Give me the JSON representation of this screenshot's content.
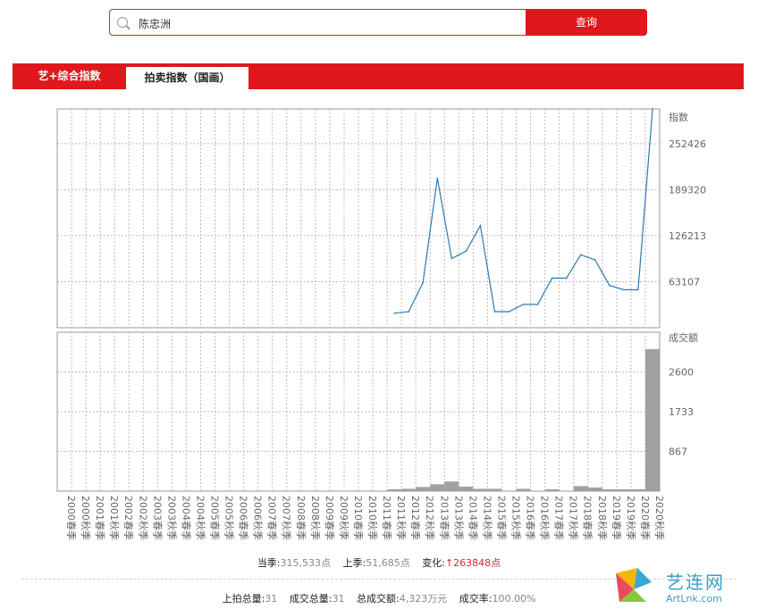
{
  "search": {
    "value": "陈忠洲",
    "button_label": "查询"
  },
  "tabs": [
    {
      "label": "艺+综合指数",
      "active": false
    },
    {
      "label": "拍卖指数（国画）",
      "active": true
    }
  ],
  "chart_data": [
    {
      "type": "line",
      "ylabel": "指数",
      "y_ticks": [
        63107,
        126213,
        189320,
        252426
      ],
      "ylim": [
        0,
        300000
      ],
      "x": [
        "2000春季",
        "2000秋季",
        "2001春季",
        "2001秋季",
        "2002春季",
        "2002秋季",
        "2003春季",
        "2003秋季",
        "2004春季",
        "2004秋季",
        "2005春季",
        "2005秋季",
        "2006春季",
        "2006秋季",
        "2007春季",
        "2007秋季",
        "2008春季",
        "2008秋季",
        "2009春季",
        "2009秋季",
        "2010春季",
        "2010秋季",
        "2011春季",
        "2011秋季",
        "2012春季",
        "2012秋季",
        "2013春季",
        "2013秋季",
        "2014春季",
        "2014秋季",
        "2015春季",
        "2015秋季",
        "2016春季",
        "2016秋季",
        "2017春季",
        "2017秋季",
        "2018春季",
        "2018秋季",
        "2019春季",
        "2019秋季",
        "2020春季",
        "2020秋季"
      ],
      "series": [
        {
          "color": "#2a7ab0",
          "values": [
            null,
            null,
            null,
            null,
            null,
            null,
            null,
            null,
            null,
            null,
            null,
            null,
            null,
            null,
            null,
            null,
            null,
            null,
            null,
            null,
            null,
            null,
            null,
            20000,
            22000,
            62000,
            205000,
            95000,
            105000,
            140000,
            22000,
            22000,
            32000,
            32000,
            68000,
            68000,
            100000,
            93000,
            58000,
            52000,
            52000,
            300000
          ]
        }
      ],
      "grid": true
    },
    {
      "type": "bar",
      "ylabel": "成交额",
      "y_ticks": [
        867,
        1733,
        2600
      ],
      "ylim": [
        0,
        3470
      ],
      "x_ref": "same as above",
      "series": [
        {
          "color": "#a0a0a0",
          "values": [
            0,
            0,
            0,
            0,
            0,
            0,
            0,
            0,
            0,
            0,
            0,
            0,
            0,
            0,
            0,
            0,
            0,
            0,
            0,
            0,
            0,
            0,
            0,
            40,
            50,
            90,
            150,
            210,
            100,
            50,
            50,
            0,
            50,
            0,
            40,
            0,
            110,
            80,
            40,
            40,
            40,
            3100
          ]
        }
      ],
      "grid": true
    }
  ],
  "stats": {
    "current_label": "当季:",
    "current_value": "315,533点",
    "prev_label": "上季:",
    "prev_value": "51,685点",
    "change_label": "变化:",
    "change_value": "↑263848点",
    "lots_label": "上拍总量:",
    "lots_value": "31",
    "sold_label": "成交总量:",
    "sold_value": "31",
    "amount_label": "总成交额:",
    "amount_value": "4,323万元",
    "rate_label": "成交率:",
    "rate_value": "100.00%"
  },
  "watermark": {
    "cn": "艺连网",
    "en": "ArtLnk.com"
  }
}
